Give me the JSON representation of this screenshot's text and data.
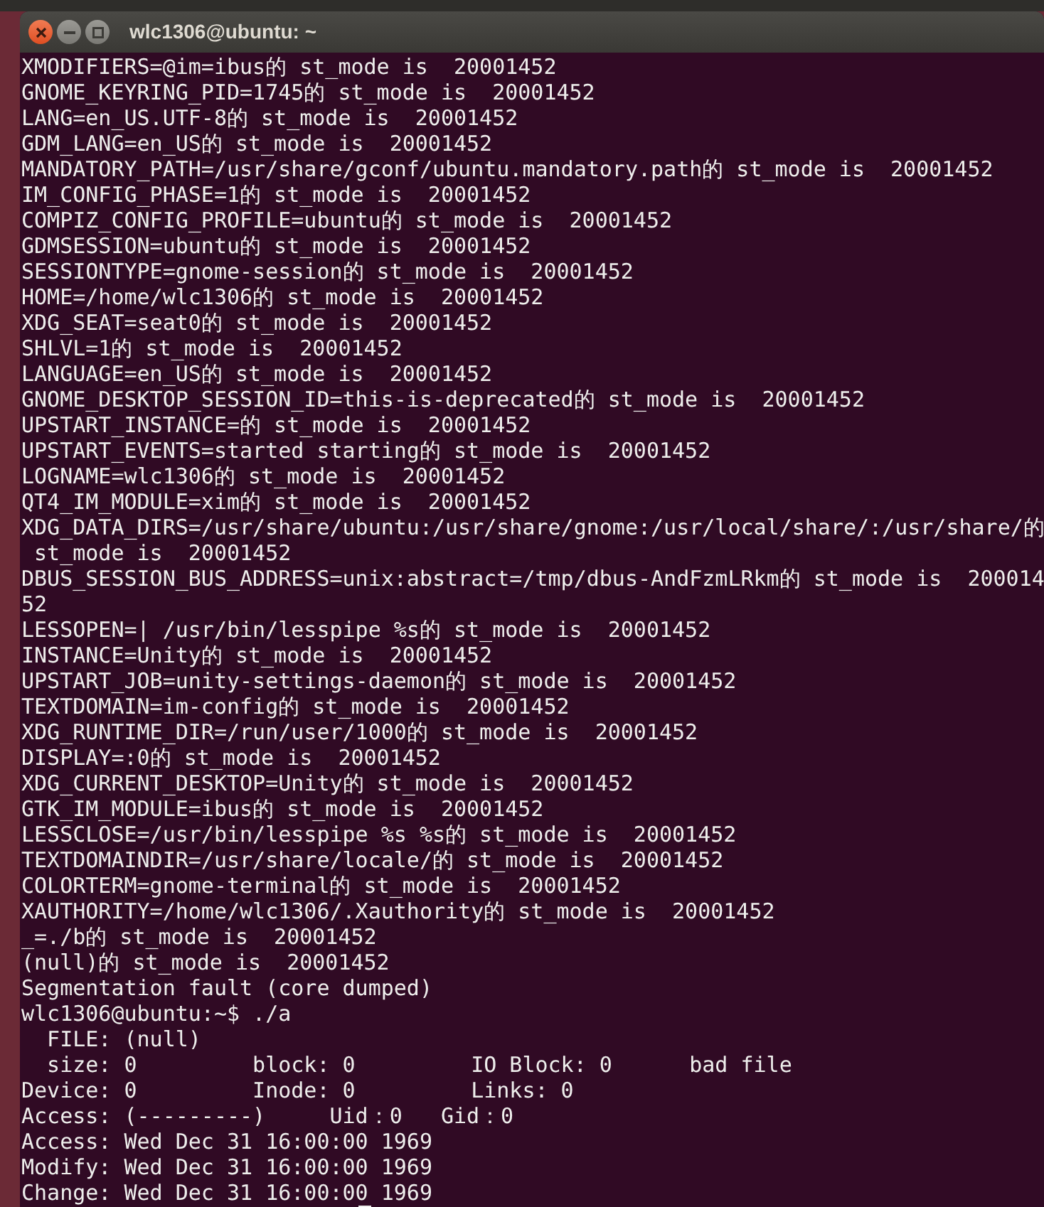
{
  "window": {
    "title": "wlc1306@ubuntu: ~"
  },
  "lines": [
    "XMODIFIERS=@im=ibus的 st_mode is  20001452",
    "GNOME_KEYRING_PID=1745的 st_mode is  20001452",
    "LANG=en_US.UTF-8的 st_mode is  20001452",
    "GDM_LANG=en_US的 st_mode is  20001452",
    "MANDATORY_PATH=/usr/share/gconf/ubuntu.mandatory.path的 st_mode is  20001452",
    "IM_CONFIG_PHASE=1的 st_mode is  20001452",
    "COMPIZ_CONFIG_PROFILE=ubuntu的 st_mode is  20001452",
    "GDMSESSION=ubuntu的 st_mode is  20001452",
    "SESSIONTYPE=gnome-session的 st_mode is  20001452",
    "HOME=/home/wlc1306的 st_mode is  20001452",
    "XDG_SEAT=seat0的 st_mode is  20001452",
    "SHLVL=1的 st_mode is  20001452",
    "LANGUAGE=en_US的 st_mode is  20001452",
    "GNOME_DESKTOP_SESSION_ID=this-is-deprecated的 st_mode is  20001452",
    "UPSTART_INSTANCE=的 st_mode is  20001452",
    "UPSTART_EVENTS=started starting的 st_mode is  20001452",
    "LOGNAME=wlc1306的 st_mode is  20001452",
    "QT4_IM_MODULE=xim的 st_mode is  20001452",
    "XDG_DATA_DIRS=/usr/share/ubuntu:/usr/share/gnome:/usr/local/share/:/usr/share/的",
    " st_mode is  20001452",
    "DBUS_SESSION_BUS_ADDRESS=unix:abstract=/tmp/dbus-AndFzmLRkm的 st_mode is  200014",
    "52",
    "LESSOPEN=| /usr/bin/lesspipe %s的 st_mode is  20001452",
    "INSTANCE=Unity的 st_mode is  20001452",
    "UPSTART_JOB=unity-settings-daemon的 st_mode is  20001452",
    "TEXTDOMAIN=im-config的 st_mode is  20001452",
    "XDG_RUNTIME_DIR=/run/user/1000的 st_mode is  20001452",
    "DISPLAY=:0的 st_mode is  20001452",
    "XDG_CURRENT_DESKTOP=Unity的 st_mode is  20001452",
    "GTK_IM_MODULE=ibus的 st_mode is  20001452",
    "LESSCLOSE=/usr/bin/lesspipe %s %s的 st_mode is  20001452",
    "TEXTDOMAINDIR=/usr/share/locale/的 st_mode is  20001452",
    "COLORTERM=gnome-terminal的 st_mode is  20001452",
    "XAUTHORITY=/home/wlc1306/.Xauthority的 st_mode is  20001452",
    "_=./b的 st_mode is  20001452",
    "(null)的 st_mode is  20001452",
    "Segmentation fault (core dumped)",
    "wlc1306@ubuntu:~$ ./a",
    "  FILE: (null)",
    "  size: 0         block: 0         IO Block: 0      bad file",
    "Device: 0         Inode: 0         Links: 0",
    "Access: (---------)     Uid：0   Gid：0",
    "Access: Wed Dec 31 16:00:00 1969",
    "Modify: Wed Dec 31 16:00:00 1969",
    "Change: Wed Dec 31 16:00:00 1969"
  ]
}
